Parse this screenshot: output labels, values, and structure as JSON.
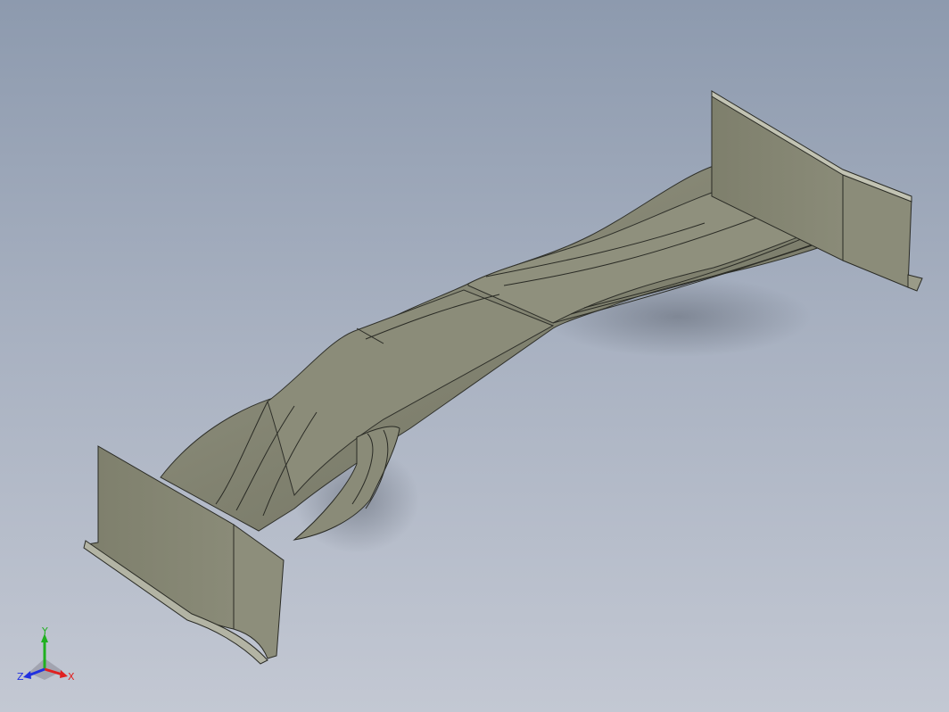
{
  "viewport": {
    "background_top": "#8d9aae",
    "background_bottom": "#c3c8d3",
    "model_color": "#7f806e",
    "edge_color": "#2a2b25"
  },
  "model": {
    "icon": "front-wing-part-icon"
  },
  "triad": {
    "icon": "view-orientation-triad-icon",
    "y_label": "Y",
    "z_label": "Z",
    "x_label": "X",
    "x_color": "#e02020",
    "y_color": "#20b020",
    "z_color": "#2030e0"
  }
}
